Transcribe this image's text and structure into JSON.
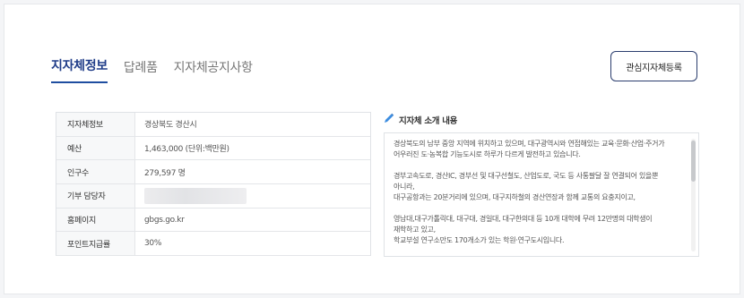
{
  "tabs": [
    {
      "label": "지자체정보",
      "active": true
    },
    {
      "label": "답례품",
      "active": false
    },
    {
      "label": "지자체공지사항",
      "active": false
    }
  ],
  "register_button": "관심지자체등록",
  "info_rows": [
    {
      "key": "지자체정보",
      "value": "경상북도 경산시"
    },
    {
      "key": "예산",
      "value": "1,463,000 (단위:백만원)"
    },
    {
      "key": "인구수",
      "value": "279,597 명"
    },
    {
      "key": "기부 담당자",
      "value": ""
    },
    {
      "key": "홈페이지",
      "value": "gbgs.go.kr"
    },
    {
      "key": "포인트지급률",
      "value": "30%"
    }
  ],
  "intro": {
    "title": "지자체 소개 내용",
    "paragraphs": [
      "경상북도의 남부 중앙 지역에 위치하고 있으며, 대구광역시와 연접해있는 교육·문화·산업·주거가\n어우러진 도·농복합 기능도시로 하루가 다르게 발전하고 있습니다.",
      "경부고속도로, 경산IC, 경부선 및 대구선철도, 산업도로, 국도 등 사통팔달 잘 연결되어 있을뿐\n아니라,\n대구공항과는 20분거리에 있으며, 대구지하철의 경산연장과 함께 교통의 요충지이고,",
      "영남대,대구가톨릭대, 대구대, 경일대, 대구한의대 등 10개 대학에 무려 12만명의 대학생이\n재학하고 있고,\n학교부설 연구소만도 170개소가 있는 학원·연구도시입니다."
    ]
  },
  "colors": {
    "accent": "#1f3c88",
    "button_border": "#2b3d6e"
  }
}
